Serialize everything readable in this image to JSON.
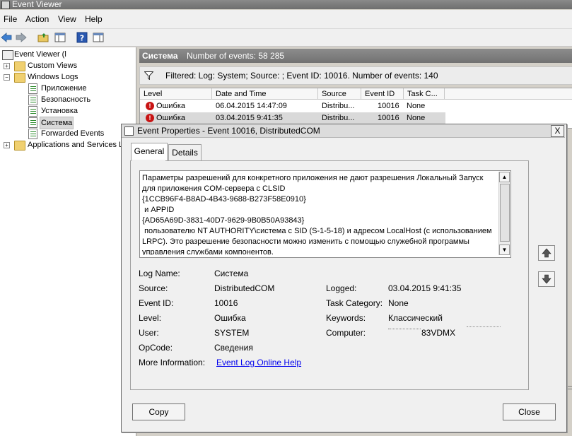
{
  "app": {
    "title": "Event Viewer"
  },
  "menu": [
    "File",
    "Action",
    "View",
    "Help"
  ],
  "toolbar": {
    "icons": [
      "back-arrow-icon",
      "forward-arrow-icon",
      "up-folder-icon",
      "show-hide-tree-icon",
      "help-icon",
      "properties-icon"
    ]
  },
  "tree": {
    "root": "Event Viewer (l",
    "custom_views": "Custom Views",
    "windows_logs": "Windows Logs",
    "app_log": "Приложение",
    "security_log": "Безопасность",
    "setup_log": "Установка",
    "system_log": "Система",
    "forwarded": "Forwarded Events",
    "apps_services": "Applications and Services Lo"
  },
  "log_header": {
    "title": "Система",
    "count": "Number of events: 58 285"
  },
  "filter": {
    "text": "Filtered: Log: System; Source: ; Event ID: 10016. Number of events: 140"
  },
  "grid": {
    "columns": [
      "Level",
      "Date and Time",
      "Source",
      "Event ID",
      "Task C..."
    ],
    "rows": [
      {
        "level": "Ошибка",
        "date": "06.04.2015 14:47:09",
        "source": "Distribu...",
        "id": "10016",
        "task": "None"
      },
      {
        "level": "Ошибка",
        "date": "03.04.2015 9:41:35",
        "source": "Distribu...",
        "id": "10016",
        "task": "None"
      }
    ]
  },
  "dialog": {
    "title": "Event Properties - Event 10016, DistributedCOM",
    "close_glyph": "X",
    "tabs": [
      "General",
      "Details"
    ],
    "description": "Параметры разрешений для конкретного приложения не дают разрешения Локальный Запуск для приложения COM-сервера с CLSID\n{1CCB96F4-B8AD-4B43-9688-B273F58E0910}\n и APPID\n{AD65A69D-3831-40D7-9629-9B0B50A93843}\n пользователю NT AUTHORITY\\система с SID (S-1-5-18) и адресом LocalHost (с использованием LRPC). Это разрешение безопасности можно изменить с помощью служебной программы управления службами компонентов.",
    "fields": {
      "log_name_label": "Log Name:",
      "log_name": "Система",
      "source_label": "Source:",
      "source": "DistributedCOM",
      "logged_label": "Logged:",
      "logged": "03.04.2015 9:41:35",
      "event_id_label": "Event ID:",
      "event_id": "10016",
      "task_label": "Task Category:",
      "task": "None",
      "level_label": "Level:",
      "level": "Ошибка",
      "keywords_label": "Keywords:",
      "keywords": "Классический",
      "user_label": "User:",
      "user": "SYSTEM",
      "computer_label": "Computer:",
      "computer": "83VDMX",
      "opcode_label": "OpCode:",
      "opcode": "Сведения",
      "more_label": "More Information:",
      "more_link": "Event Log Online Help"
    },
    "copy_button": "Copy",
    "close_button": "Close"
  }
}
